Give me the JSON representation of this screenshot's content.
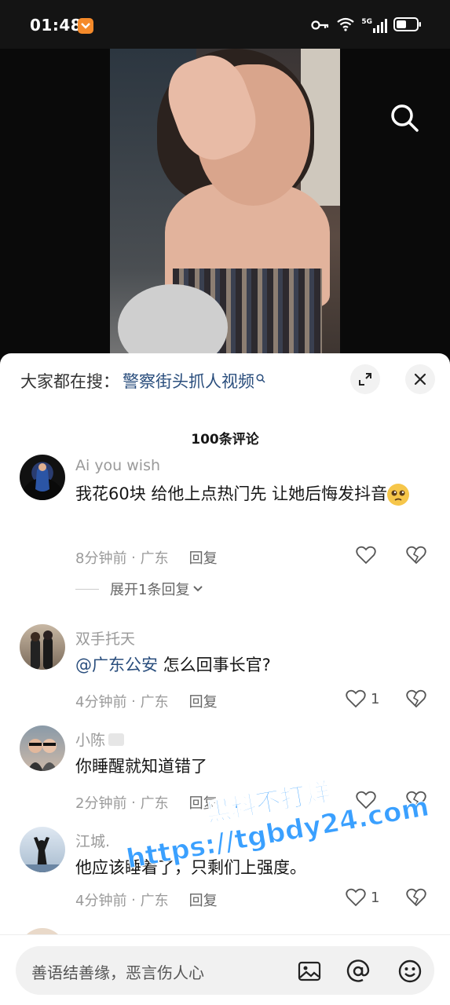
{
  "status_bar": {
    "time": "01:48",
    "network": "5G"
  },
  "sheet": {
    "hot_search_prefix": "大家都在搜：",
    "hot_search_term": "警察街头抓人视频",
    "comment_count": "100条评论"
  },
  "comments": [
    {
      "username": "Ai you wish",
      "text": "我花60块  给他上点热门先    让她后悔发抖音",
      "time": "8分钟前",
      "location": "广东",
      "reply_label": "回复",
      "likes": "",
      "expand_label": "展开1条回复"
    },
    {
      "username": "双手托天",
      "mention": "@广东公安",
      "text": " 怎么回事长官?",
      "time": "4分钟前",
      "location": "广东",
      "reply_label": "回复",
      "likes": "1"
    },
    {
      "username": "小陈",
      "text": "你睡醒就知道错了",
      "time": "2分钟前",
      "location": "广东",
      "reply_label": "回复",
      "likes": ""
    },
    {
      "username": "江城.",
      "text": "他应该睡着了，只剩们上强度。",
      "time": "4分钟前",
      "location": "广东",
      "reply_label": "回复",
      "likes": "1"
    }
  ],
  "watermark": {
    "line1": "黑料不打烊",
    "line2": "https://tgbdy24.com"
  },
  "input": {
    "placeholder": "善语结善缘，恶言伤人心"
  },
  "colors": {
    "accent_link": "#2a4e7d",
    "watermark": "#3aa0ff"
  }
}
